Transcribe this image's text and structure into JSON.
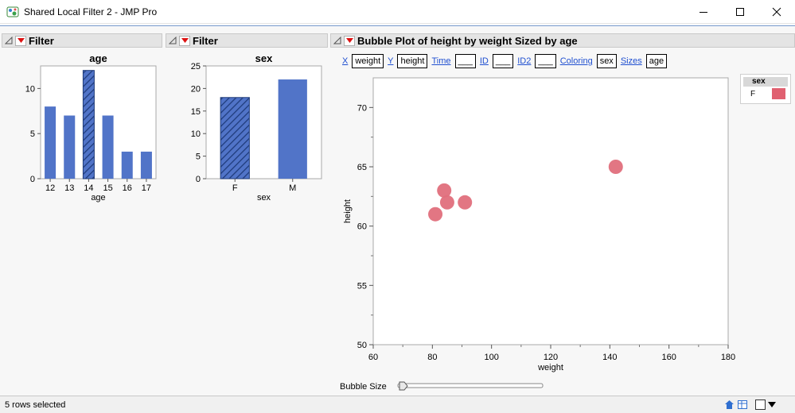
{
  "window": {
    "title": "Shared Local Filter 2 - JMP Pro"
  },
  "filter1": {
    "header": "Filter",
    "chart_title": "age",
    "xlabel": "age"
  },
  "filter2": {
    "header": "Filter",
    "chart_title": "sex",
    "xlabel": "sex"
  },
  "bubble": {
    "header": "Bubble Plot of height by weight Sized by age",
    "roles": [
      {
        "label": "X",
        "value": "weight"
      },
      {
        "label": "Y",
        "value": "height"
      },
      {
        "label": "Time",
        "value": "___"
      },
      {
        "label": "ID",
        "value": "___"
      },
      {
        "label": "ID2",
        "value": "___"
      },
      {
        "label": "Coloring",
        "value": "sex"
      },
      {
        "label": "Sizes",
        "value": "age"
      }
    ],
    "bubble_size_label": "Bubble Size",
    "legend": {
      "title": "sex",
      "item": "F",
      "color": "#e06070"
    }
  },
  "status": {
    "text": "5 rows selected"
  },
  "colors": {
    "bar": "#5174c8",
    "bubble": "#e06f7c"
  },
  "chart_data": [
    {
      "type": "bar",
      "title": "age",
      "xlabel": "age",
      "categories": [
        "12",
        "13",
        "14",
        "15",
        "16",
        "17"
      ],
      "values": [
        8,
        7,
        12,
        7,
        3,
        3
      ],
      "selected": [
        "14"
      ],
      "ylim": [
        0,
        12.5
      ],
      "yticks": [
        0,
        5,
        10
      ]
    },
    {
      "type": "bar",
      "title": "sex",
      "xlabel": "sex",
      "categories": [
        "F",
        "M"
      ],
      "values": [
        18,
        22
      ],
      "selected": [
        "F"
      ],
      "ylim": [
        0,
        25
      ],
      "yticks": [
        0,
        5,
        10,
        15,
        20,
        25
      ]
    },
    {
      "type": "scatter",
      "xlabel": "weight",
      "ylabel": "height",
      "xlim": [
        60,
        180
      ],
      "ylim": [
        50,
        72.5
      ],
      "xticks": [
        60,
        80,
        100,
        120,
        140,
        160,
        180
      ],
      "yticks": [
        50,
        55,
        60,
        65,
        70
      ],
      "points": [
        {
          "x": 81,
          "y": 61
        },
        {
          "x": 84,
          "y": 63
        },
        {
          "x": 85,
          "y": 62
        },
        {
          "x": 91,
          "y": 62
        },
        {
          "x": 142,
          "y": 65
        }
      ]
    }
  ]
}
